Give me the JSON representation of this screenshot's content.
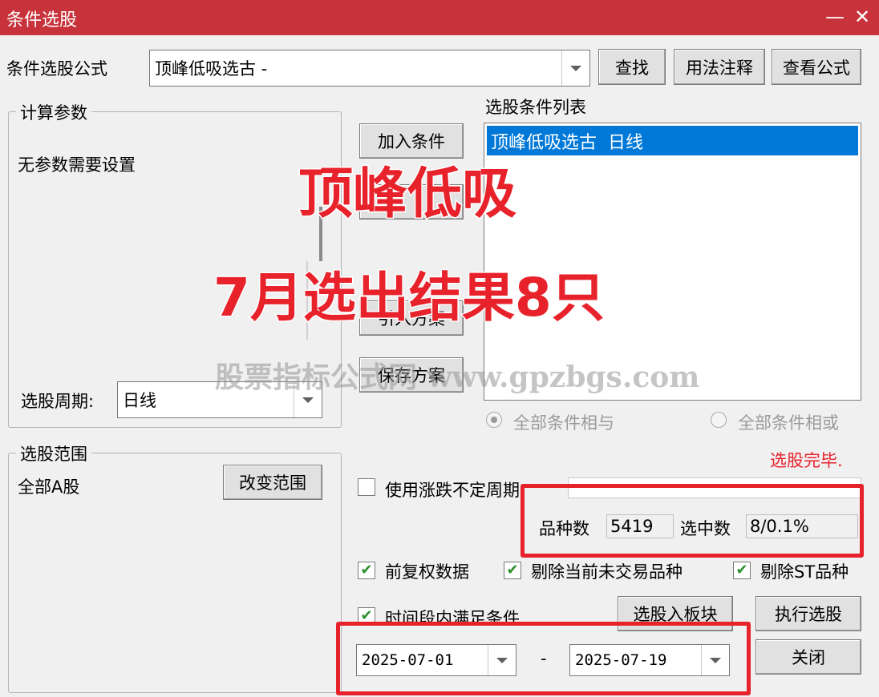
{
  "window": {
    "title": "条件选股",
    "minimize": "—",
    "close": "✕"
  },
  "formula": {
    "label": "条件选股公式",
    "value": "顶峰低吸选古  -",
    "find": "查找",
    "usage": "用法注释",
    "view": "查看公式"
  },
  "params": {
    "title": "计算参数",
    "message": "无参数需要设置",
    "period_label": "选股周期:",
    "period_value": "日线"
  },
  "mid_buttons": {
    "add": "加入条件",
    "import": "引入方案",
    "save": "保存方案"
  },
  "condition_list": {
    "title": "选股条件列表",
    "items": [
      "顶峰低吸选古  日线"
    ]
  },
  "logic": {
    "and_label": "全部条件相与",
    "or_label": "全部条件相或"
  },
  "status": {
    "text": "选股完毕.",
    "color": "#e8222b"
  },
  "range": {
    "title": "选股范围",
    "value": "全部A股",
    "change": "改变范围"
  },
  "options": {
    "variable_period": "使用涨跌不定周期",
    "count_label": "品种数",
    "count_value": "5419",
    "selected_label": "选中数",
    "selected_value": "8/0.1%",
    "pre_adjust": "前复权数据",
    "exclude_untraded": "剔除当前未交易品种",
    "exclude_st": "剔除ST品种",
    "in_period": "时间段内满足条件"
  },
  "dates": {
    "start": "2025-07-01",
    "separator": "-",
    "end": "2025-07-19"
  },
  "actions": {
    "to_block": "选股入板块",
    "run": "执行选股",
    "close": "关闭"
  },
  "overlay": {
    "line1": "顶峰低吸",
    "line2": "7月选出结果8只",
    "watermark": "股票指标公式网 www.gpzbgs.com"
  },
  "colors": {
    "title_bar": "#c8323a",
    "selection": "#0078d7",
    "highlight_box": "#e8222b"
  }
}
